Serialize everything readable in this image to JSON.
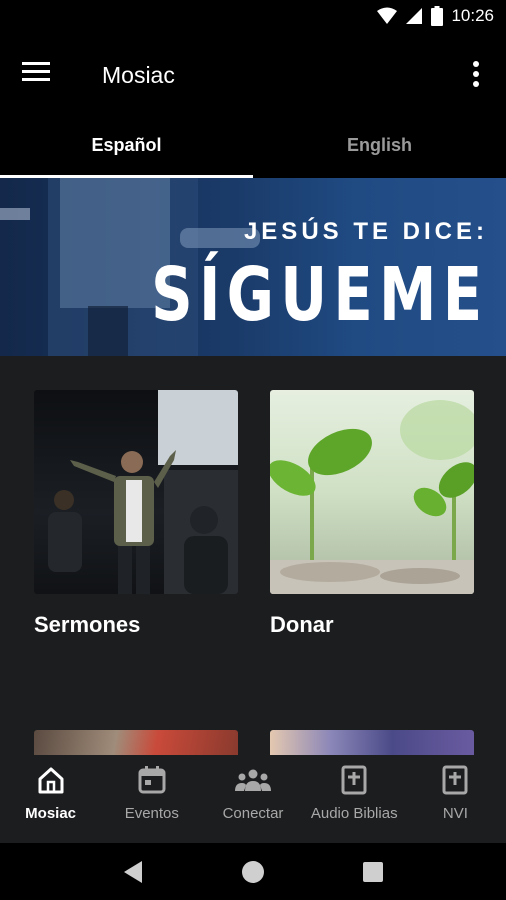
{
  "status_bar": {
    "time": "10:26",
    "icons": [
      "wifi-icon",
      "signal-icon",
      "battery-icon"
    ]
  },
  "app_bar": {
    "title": "Mosiac",
    "menu_icon": "hamburger-menu-icon",
    "more_icon": "more-vert-icon"
  },
  "tabs": [
    {
      "label": "Español",
      "active": true
    },
    {
      "label": "English",
      "active": false
    }
  ],
  "banner": {
    "line1": "JESÚS TE DICE:",
    "line2": "SÍGUEME"
  },
  "cards": [
    {
      "label": "Sermones"
    },
    {
      "label": "Donar"
    }
  ],
  "bottom_nav": [
    {
      "label": "Mosiac",
      "icon": "home-icon",
      "active": true
    },
    {
      "label": "Eventos",
      "icon": "calendar-icon",
      "active": false
    },
    {
      "label": "Conectar",
      "icon": "group-icon",
      "active": false
    },
    {
      "label": "Audio Biblias",
      "icon": "bible-icon",
      "active": false
    },
    {
      "label": "NVI",
      "icon": "bible-icon",
      "active": false
    }
  ],
  "system_nav": [
    "back-icon",
    "home-circle-icon",
    "recents-icon"
  ],
  "colors": {
    "background": "#1c1d1f",
    "bar": "#000000",
    "banner": "#1f4a82",
    "inactive_text": "#a8a8a8"
  }
}
